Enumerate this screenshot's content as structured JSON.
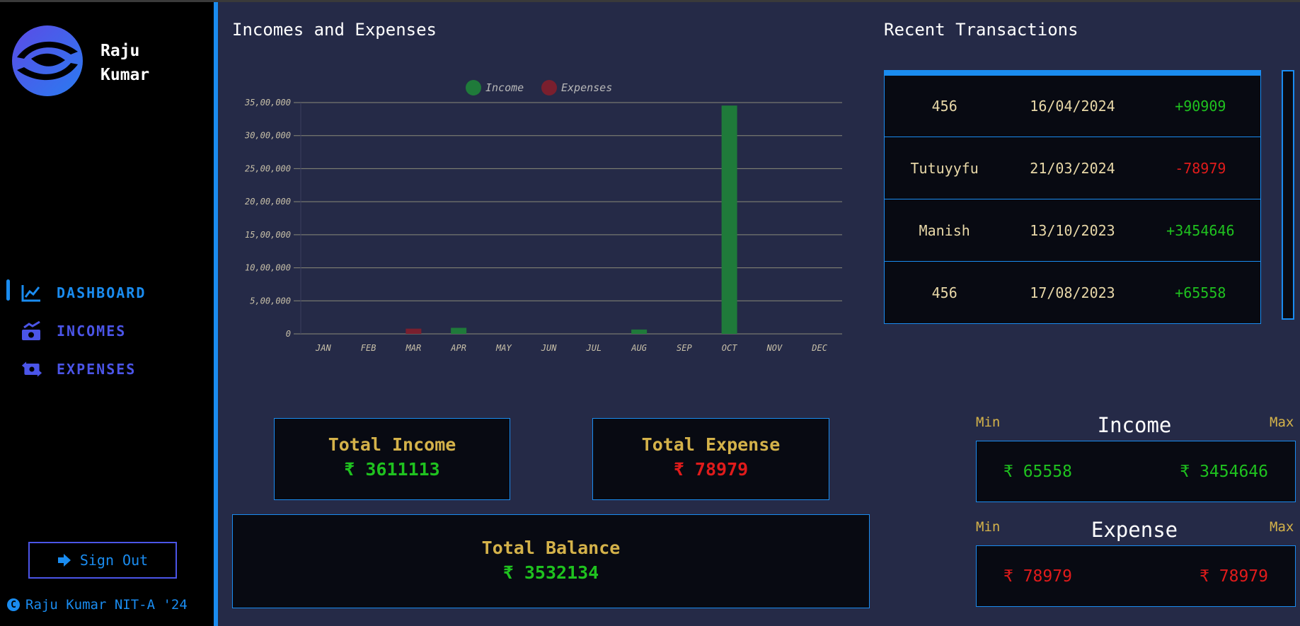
{
  "profile": {
    "name_line1": "Raju",
    "name_line2": "Kumar"
  },
  "nav": [
    {
      "label": "DASHBOARD",
      "icon": "chart-line-icon",
      "active": true
    },
    {
      "label": "INCOMES",
      "icon": "money-trend-icon",
      "active": false
    },
    {
      "label": "EXPENSES",
      "icon": "money-exchange-icon",
      "active": false
    }
  ],
  "signout": {
    "label": "Sign Out"
  },
  "footer": {
    "text": "Raju Kumar NIT-A '24"
  },
  "main": {
    "chart_title": "Incomes and Expenses",
    "recent_title": "Recent Transactions"
  },
  "colors": {
    "accent": "#1a8cf0",
    "income": "#1fc21f",
    "expense": "#e01b1b",
    "gold": "#d4b24a",
    "bg": "#252a47"
  },
  "chart_data": {
    "type": "bar",
    "categories": [
      "JAN",
      "FEB",
      "MAR",
      "APR",
      "MAY",
      "JUN",
      "JUL",
      "AUG",
      "SEP",
      "OCT",
      "NOV",
      "DEC"
    ],
    "series": [
      {
        "name": "Income",
        "color": "#1f7a3a",
        "values": [
          0,
          0,
          0,
          90909,
          0,
          0,
          0,
          65558,
          0,
          3454646,
          0,
          0
        ]
      },
      {
        "name": "Expenses",
        "color": "#7a1f2e",
        "values": [
          0,
          0,
          78979,
          0,
          0,
          0,
          0,
          0,
          0,
          0,
          0,
          0
        ]
      }
    ],
    "yticks": [
      "0",
      "5,00,000",
      "10,00,000",
      "15,00,000",
      "20,00,000",
      "25,00,000",
      "30,00,000",
      "35,00,000"
    ],
    "ylim": [
      0,
      3500000
    ],
    "legend_position": "top"
  },
  "totals": {
    "income_title": "Total Income",
    "income_value": "₹ 3611113",
    "expense_title": "Total Expense",
    "expense_value": "₹ 78979",
    "balance_title": "Total Balance",
    "balance_value": "₹ 3532134"
  },
  "transactions": [
    {
      "name": "456",
      "date": "16/04/2024",
      "amount": "+90909",
      "type": "income"
    },
    {
      "name": "Tutuyyfu",
      "date": "21/03/2024",
      "amount": "-78979",
      "type": "expense"
    },
    {
      "name": "Manish",
      "date": "13/10/2023",
      "amount": "+3454646",
      "type": "income"
    },
    {
      "name": "456",
      "date": "17/08/2023",
      "amount": "+65558",
      "type": "income"
    }
  ],
  "minmax": {
    "min_label": "Min",
    "max_label": "Max",
    "income": {
      "title": "Income",
      "min": "₹ 65558",
      "max": "₹ 3454646"
    },
    "expense": {
      "title": "Expense",
      "min": "₹ 78979",
      "max": "₹ 78979"
    }
  }
}
